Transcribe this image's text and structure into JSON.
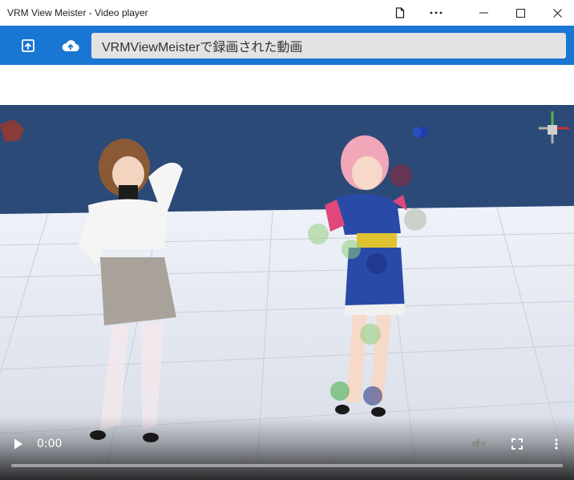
{
  "window": {
    "title": "VRM View Meister - Video player"
  },
  "appbar": {
    "address_text": "VRMViewMeisterで録画された動画"
  },
  "player": {
    "current_time": "0:00",
    "progress": 0
  },
  "colors": {
    "appbar": "#1976d2",
    "sky": "#2c4a78",
    "floor": "#dfe4ee"
  }
}
